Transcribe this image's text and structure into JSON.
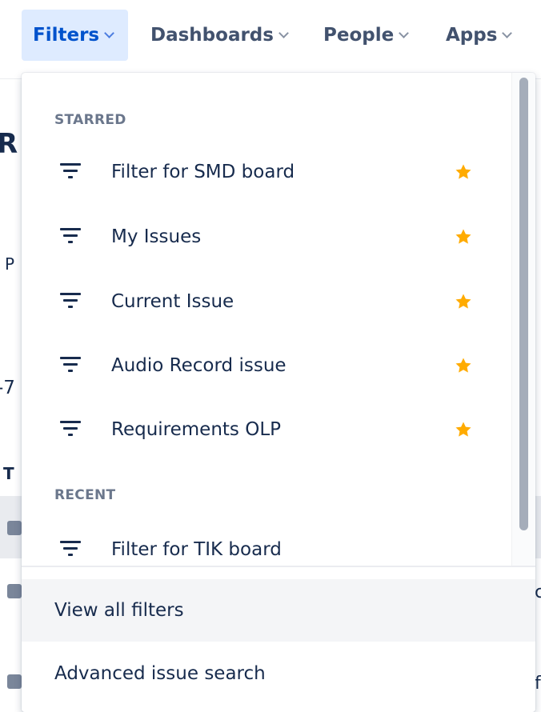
{
  "nav": {
    "items": [
      {
        "label": "Filters"
      },
      {
        "label": "Dashboards"
      },
      {
        "label": "People"
      },
      {
        "label": "Apps"
      }
    ]
  },
  "background": {
    "fragments": [
      "R",
      "P",
      "-7",
      "T"
    ],
    "right_chars": [
      "c",
      "f"
    ]
  },
  "dropdown": {
    "starred_heading": "STARRED",
    "starred": [
      {
        "label": "Filter for SMD board",
        "icon": "filter-icon",
        "starred": true
      },
      {
        "label": "My Issues",
        "icon": "filter-icon",
        "starred": true
      },
      {
        "label": "Current Issue",
        "icon": "filter-icon",
        "starred": true
      },
      {
        "label": "Audio Record issue",
        "icon": "filter-icon",
        "starred": true
      },
      {
        "label": "Requirements OLP",
        "icon": "filter-icon",
        "starred": true
      }
    ],
    "recent_heading": "RECENT",
    "recent": [
      {
        "label": "Filter for TIK board",
        "icon": "filter-icon"
      }
    ],
    "footer": {
      "view_all": "View all filters",
      "advanced": "Advanced issue search"
    }
  },
  "colors": {
    "accent": "#0052cc",
    "active_bg": "#deebff",
    "star": "#ffab00",
    "text": "#172b4d",
    "muted": "#6b778c"
  }
}
